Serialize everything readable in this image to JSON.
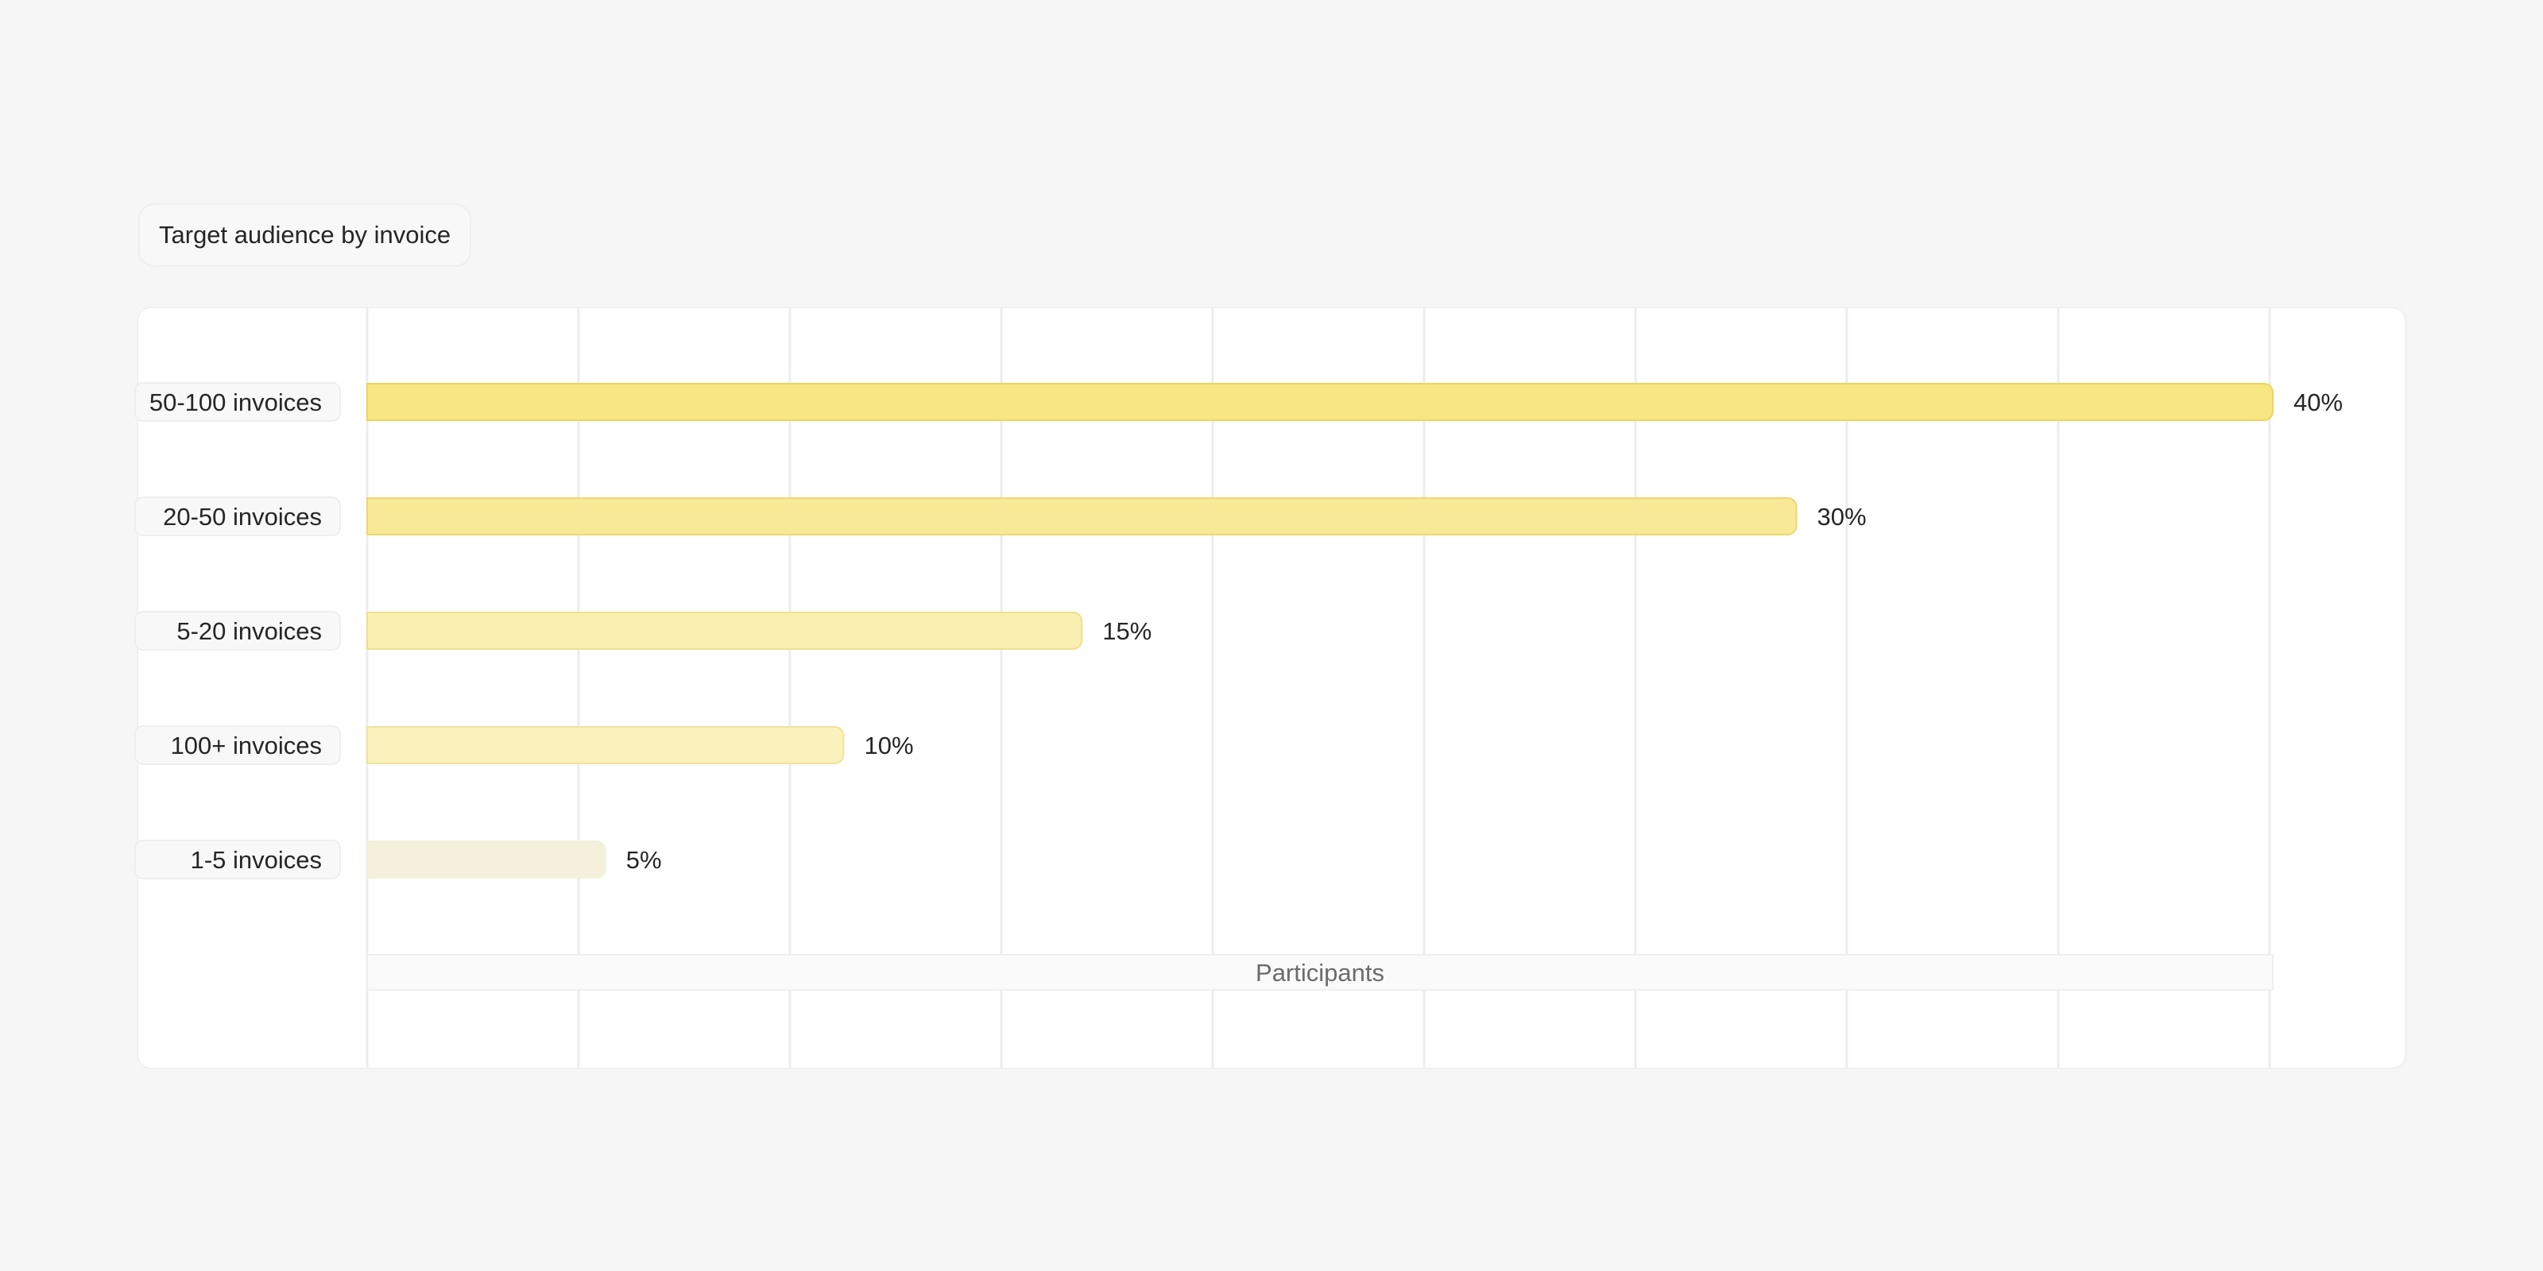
{
  "chart_data": {
    "type": "bar",
    "orientation": "horizontal",
    "title": "Target audience by invoice",
    "xlabel": "Participants",
    "ylabel": "",
    "categories": [
      "50-100 invoices",
      "20-50 invoices",
      "5-20 invoices",
      "100+ invoices",
      "1-5 invoices"
    ],
    "values": [
      40,
      30,
      15,
      10,
      5
    ],
    "value_labels": [
      "40%",
      "30%",
      "15%",
      "10%",
      "5%"
    ],
    "xlim": [
      0,
      40
    ],
    "grid": true,
    "tick_labels_visible": false,
    "legend": "none",
    "colors": {
      "bar_fills": [
        "#f7e682",
        "#f8e997",
        "#f9efb0",
        "#faf1bd",
        "#f4f0dc"
      ],
      "bar_strokes": [
        "#ecd55f",
        "#ecd872",
        "#efe090",
        "#f0e39c",
        "#f4f0dc"
      ],
      "grid": "#ededed",
      "text": "#262626",
      "axis_label_text": "#6b6b6b"
    }
  }
}
